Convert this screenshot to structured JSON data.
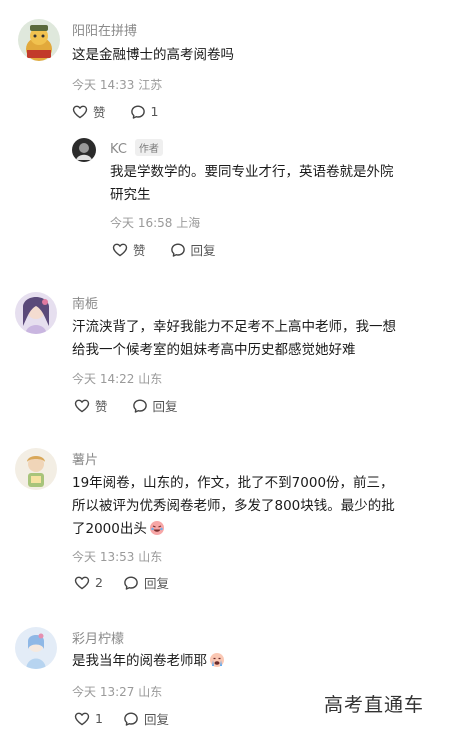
{
  "comments": [
    {
      "user": "阳阳在拼搏",
      "text": [
        "这是金融博士的高考阅卷吗"
      ],
      "time": "今天 14:33",
      "location": "江苏",
      "like_label": "赞",
      "reply_count": "1"
    },
    {
      "user": "KC",
      "author_tag": "作者",
      "text": [
        "我是学数学的。要同专业才行，英语卷就是外院",
        "研究生"
      ],
      "time": "今天 16:58",
      "location": "上海",
      "like_label": "赞",
      "reply_label": "回复"
    },
    {
      "user": "南栀",
      "text": [
        "汗流浃背了，幸好我能力不足考不上高中老师，我一想",
        "给我一个候考室的姐妹考高中历史都感觉她好难"
      ],
      "time": "今天 14:22",
      "location": "山东",
      "like_label": "赞",
      "reply_label": "回复"
    },
    {
      "user": "薯片",
      "text": [
        "19年阅卷，山东的，作文，批了不到7000份，前三，",
        "所以被评为优秀阅卷老师，多发了800块钱。最少的批",
        "了2000出头"
      ],
      "time": "今天 13:53",
      "location": "山东",
      "like_count": "2",
      "reply_label": "回复"
    },
    {
      "user": "彩月柠檬",
      "text": [
        "是我当年的阅卷老师耶"
      ],
      "time": "今天 13:27",
      "location": "山东",
      "like_count": "1",
      "reply_label": "回复"
    }
  ],
  "watermark": "高考直通车",
  "icons": {
    "like": "heart-outline-icon",
    "comment": "speech-bubble-icon",
    "emoji_1": "crying-laughing-emoji",
    "emoji_2": "crying-emoji"
  },
  "colors": {
    "text": "#1a1a1a",
    "username": "#8a8a8a",
    "meta": "#9a9a9a",
    "action": "#555555"
  }
}
